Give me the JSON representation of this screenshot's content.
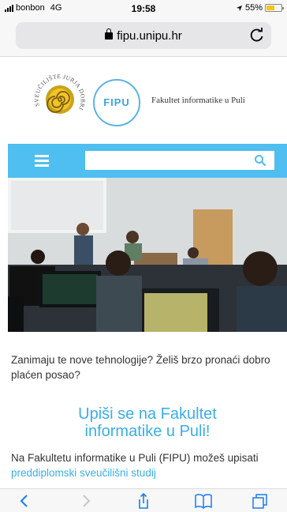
{
  "status_bar": {
    "carrier": "bonbon",
    "network": "4G",
    "time": "19:58",
    "battery": "55%",
    "battery_level": 0.55
  },
  "browser": {
    "url": "fipu.unipu.hr"
  },
  "header": {
    "seal_text": "SVEUČILIŠTE JURJA DOBRILE U PULI",
    "logo_text": "FIPU",
    "faculty_name": "Fakultet informatike u Puli"
  },
  "nav": {
    "search_placeholder": ""
  },
  "content": {
    "intro": "Zanimaju te nove tehnologije? Želiš brzo pronaći dobro plaćen posao?",
    "cta_line1": "Upiši se na Fakultet",
    "cta_line2": "informatike u Puli!",
    "body_prefix": "Na Fakultetu informatike u Puli (FIPU) možeš upisati ",
    "body_link": "preddiplomski sveučilišni studij"
  },
  "colors": {
    "accent": "#4fbef0",
    "link": "#3aaee8",
    "battery": "#f5c518"
  }
}
